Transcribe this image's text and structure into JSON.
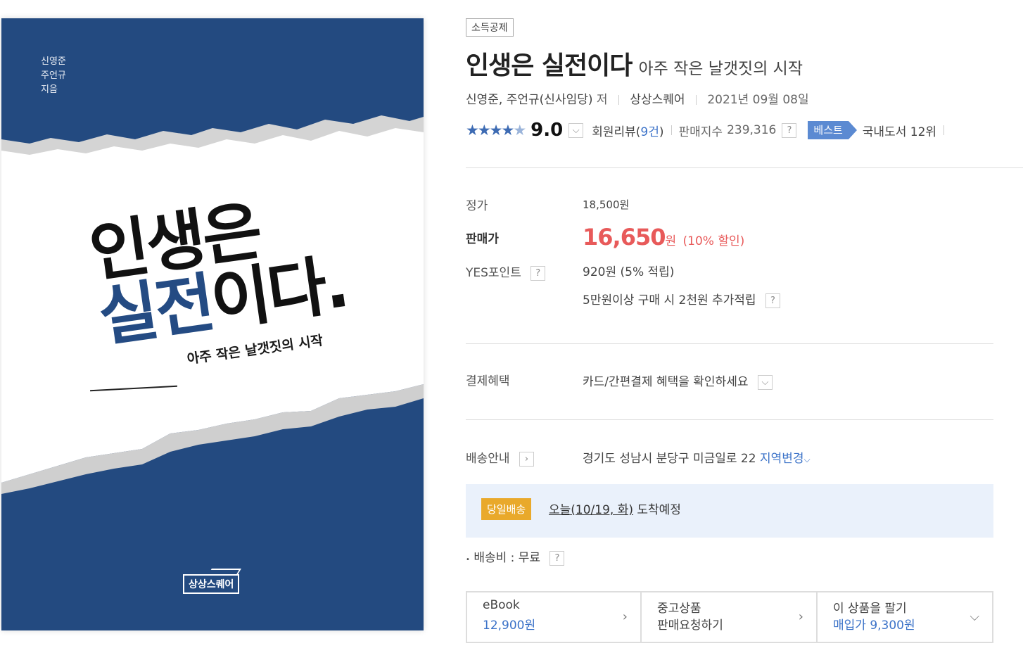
{
  "cover": {
    "authors": [
      "신영준",
      "주언규",
      "지음"
    ],
    "title_line1": "인생은",
    "title_line2_blue": "실전",
    "title_line2_rest": "이다.",
    "subtitle": "아주 작은 날갯짓의 시작",
    "publisher": "상상스퀘어",
    "colors": {
      "navy": "#234a80",
      "paper": "#ffffff",
      "torn_edge": "#d6d6d6"
    }
  },
  "product": {
    "tax_badge": "소득공제",
    "title": "인생은 실전이다",
    "subtitle": "아주 작은 날갯짓의 시작",
    "authors": "신영준, 주언규",
    "author_note": "(신사임당)",
    "author_suffix": "저",
    "publisher": "상상스퀘어",
    "pub_date": "2021년 09월 08일",
    "rating_stars": 4.5,
    "score": "9.0",
    "review_label": "회원리뷰(",
    "review_count": "9건",
    "review_close": ")",
    "sales_index_label": "판매지수",
    "sales_index": "239,316",
    "help_mark": "?",
    "best_badge": "베스트",
    "rank_text": "국내도서 12위"
  },
  "price": {
    "list_label": "정가",
    "list_price": "18,500원",
    "sale_label": "판매가",
    "sale_price": "16,650",
    "sale_unit": "원",
    "discount": "(10% 할인)",
    "point_label": "YES포인트",
    "point_value": "920원 (5% 적립)",
    "point_extra": "5만원이상 구매 시 2천원 추가적립"
  },
  "payment": {
    "label": "결제혜택",
    "value": "카드/간편결제 혜택을 확인하세요"
  },
  "delivery": {
    "label": "배송안내",
    "address": "경기도 성남시 분당구 미금일로 22",
    "change_link": "지역변경",
    "sameday_badge": "당일배송",
    "arrival_date": "오늘(10/19, 화)",
    "arrival_suffix": "도착예정",
    "fee_label": "배송비 : 무료"
  },
  "options": [
    {
      "title": "eBook",
      "sub": "12,900원",
      "sub_blue": true,
      "icon": "chevron-right-icon"
    },
    {
      "title": "중고상품",
      "sub": "판매요청하기",
      "sub_blue": false,
      "icon": "chevron-right-icon"
    },
    {
      "title": "이 상품을 팔기",
      "sub": "매입가 9,300원",
      "sub_blue": true,
      "icon": "chevron-down-icon"
    }
  ],
  "colors": {
    "accent_red": "#e85a5a",
    "link_blue": "#3b72c8",
    "best_blue": "#5b8ad2",
    "sameday_orange": "#e9a92b",
    "sameday_bg": "#eaf1fb"
  }
}
